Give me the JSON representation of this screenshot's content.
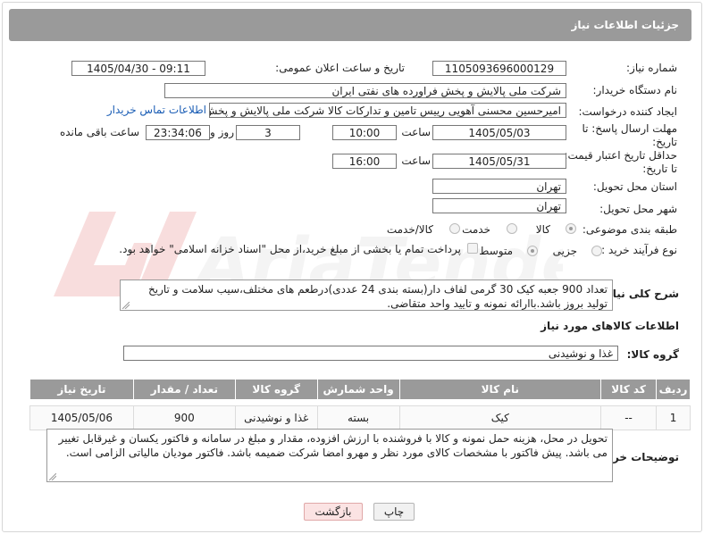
{
  "page": {
    "title": "جزئیات اطلاعات نیاز"
  },
  "watermark": {
    "text": "AriaTender.net"
  },
  "fields": {
    "need_number": {
      "label": "شماره نیاز:",
      "value": "1105093696000129"
    },
    "announce": {
      "label": "تاریخ و ساعت اعلان عمومی:",
      "value": "1405/04/30 - 09:11"
    },
    "buyer_org": {
      "label": "نام دستگاه خریدار:",
      "value": "شرکت ملی پالایش و پخش فراورده های نفتی ایران"
    },
    "creator": {
      "label": "ایجاد کننده درخواست:",
      "value": "امیرحسین محسنی آهویی رییس تامین و تدارکات کالا شرکت ملی پالایش و پخش",
      "contact_link": "اطلاعات تماس خریدار"
    },
    "deadline": {
      "label_line1": "مهلت ارسال پاسخ: تا",
      "label_line2": "تاریخ:",
      "date": "1405/05/03",
      "time_label": "ساعت",
      "time": "10:00",
      "days": "3",
      "days_label": "روز و",
      "remaining": "23:34:06",
      "remaining_label": "ساعت باقی مانده"
    },
    "price_validity": {
      "label_line1": "حداقل تاریخ اعتبار قیمت:",
      "label_line2": "تا تاریخ:",
      "date": "1405/05/31",
      "time_label": "ساعت",
      "time": "16:00"
    },
    "province": {
      "label": "استان محل تحویل:",
      "value": "تهران"
    },
    "city": {
      "label": "شهر محل تحویل:",
      "value": "تهران"
    },
    "category": {
      "label": "طبقه بندی موضوعی:",
      "options": [
        "کالا",
        "خدمت",
        "کالا/خدمت"
      ],
      "selected": "کالا"
    },
    "process": {
      "label": "نوع فرآیند خرید :",
      "options": [
        "جزیی",
        "متوسط"
      ],
      "selected": "متوسط",
      "note": "پرداخت تمام یا بخشی از مبلغ خرید،از محل \"اسناد خزانه اسلامی\" خواهد بود."
    }
  },
  "description": {
    "label": "شرح کلی نیاز:",
    "text": "تعداد 900 جعبه کیک 30 گرمی لفاف دار(بسته بندی 24 عددی)درطعم های مختلف،سیب سلامت و تاریخ تولید بروز باشد.باارائه نمونه و تایید واحد متقاضی."
  },
  "goods_section": {
    "title": "اطلاعات کالاهای مورد نیاز"
  },
  "goods_group": {
    "label": "گروه کالا:",
    "value": "غذا و نوشیدنی"
  },
  "table": {
    "headers": [
      "ردیف",
      "کد کالا",
      "نام کالا",
      "واحد شمارش",
      "گروه کالا",
      "تعداد / مقدار",
      "تاریخ نیاز"
    ],
    "rows": [
      [
        "1",
        "--",
        "کیک",
        "بسته",
        "غذا و نوشیدنی",
        "900",
        "1405/05/06"
      ]
    ]
  },
  "buyer_notes": {
    "label": "توضیحات خریدار:",
    "text": "تحویل در محل، هزینه حمل نمونه و کالا با فروشنده با ارزش افزوده، مقدار و مبلغ در سامانه و فاکتور یکسان و غیرقابل تغییر می باشد. پیش فاکتور با مشخصات کالای مورد نظر و مهرو امضا شرکت ضمیمه باشد. فاکتور مودیان مالیاتی الزامی است."
  },
  "buttons": {
    "print": "چاپ",
    "back": "بازگشت"
  }
}
